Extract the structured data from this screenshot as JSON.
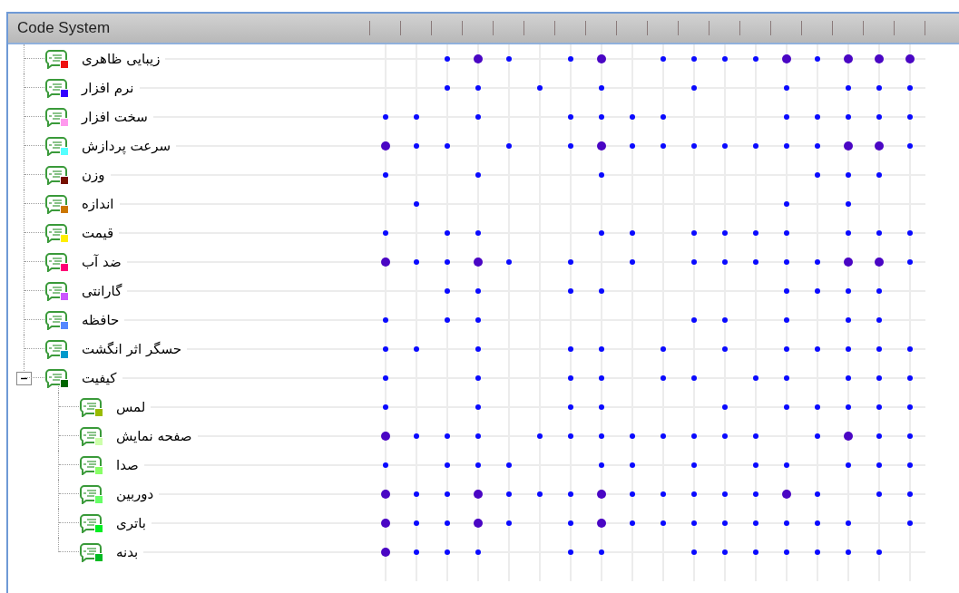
{
  "header": {
    "title": "Code System"
  },
  "codes": [
    {
      "name": "زیبایی ظاهری",
      "color": "#ee1111",
      "cells": [
        {
          "kind": "empty"
        },
        {
          "kind": "empty"
        },
        {
          "kind": "small"
        },
        {
          "kind": "large"
        },
        {
          "kind": "small"
        },
        {
          "kind": "empty"
        },
        {
          "kind": "small"
        },
        {
          "kind": "large"
        },
        {
          "kind": "empty"
        },
        {
          "kind": "small"
        },
        {
          "kind": "small"
        },
        {
          "kind": "small"
        },
        {
          "kind": "small"
        },
        {
          "kind": "large"
        },
        {
          "kind": "small"
        },
        {
          "kind": "large"
        },
        {
          "kind": "large"
        },
        {
          "kind": "large"
        }
      ]
    },
    {
      "name": "نرم افزار",
      "color": "#3300ff",
      "cells": [
        {
          "kind": "empty"
        },
        {
          "kind": "empty"
        },
        {
          "kind": "small"
        },
        {
          "kind": "small"
        },
        {
          "kind": "empty"
        },
        {
          "kind": "small"
        },
        {
          "kind": "empty"
        },
        {
          "kind": "small"
        },
        {
          "kind": "empty"
        },
        {
          "kind": "empty"
        },
        {
          "kind": "small"
        },
        {
          "kind": "empty"
        },
        {
          "kind": "empty"
        },
        {
          "kind": "small"
        },
        {
          "kind": "empty"
        },
        {
          "kind": "small"
        },
        {
          "kind": "small"
        },
        {
          "kind": "small"
        }
      ]
    },
    {
      "name": "سخت افزار",
      "color": "#ff99ee",
      "cells": [
        {
          "kind": "small"
        },
        {
          "kind": "small"
        },
        {
          "kind": "empty"
        },
        {
          "kind": "small"
        },
        {
          "kind": "empty"
        },
        {
          "kind": "empty"
        },
        {
          "kind": "small"
        },
        {
          "kind": "small"
        },
        {
          "kind": "small"
        },
        {
          "kind": "small"
        },
        {
          "kind": "empty"
        },
        {
          "kind": "empty"
        },
        {
          "kind": "empty"
        },
        {
          "kind": "small"
        },
        {
          "kind": "small"
        },
        {
          "kind": "small"
        },
        {
          "kind": "small"
        },
        {
          "kind": "small"
        }
      ]
    },
    {
      "name": "سرعت پردازش",
      "color": "#55ffff",
      "cells": [
        {
          "kind": "large"
        },
        {
          "kind": "small"
        },
        {
          "kind": "small"
        },
        {
          "kind": "empty"
        },
        {
          "kind": "small"
        },
        {
          "kind": "empty"
        },
        {
          "kind": "small"
        },
        {
          "kind": "large"
        },
        {
          "kind": "small"
        },
        {
          "kind": "small"
        },
        {
          "kind": "small"
        },
        {
          "kind": "small"
        },
        {
          "kind": "small"
        },
        {
          "kind": "small"
        },
        {
          "kind": "small"
        },
        {
          "kind": "large"
        },
        {
          "kind": "large"
        },
        {
          "kind": "small"
        }
      ]
    },
    {
      "name": "وزن",
      "color": "#771100",
      "cells": [
        {
          "kind": "small"
        },
        {
          "kind": "empty"
        },
        {
          "kind": "empty"
        },
        {
          "kind": "small"
        },
        {
          "kind": "empty"
        },
        {
          "kind": "empty"
        },
        {
          "kind": "empty"
        },
        {
          "kind": "small"
        },
        {
          "kind": "empty"
        },
        {
          "kind": "empty"
        },
        {
          "kind": "empty"
        },
        {
          "kind": "empty"
        },
        {
          "kind": "empty"
        },
        {
          "kind": "empty"
        },
        {
          "kind": "small"
        },
        {
          "kind": "small"
        },
        {
          "kind": "small"
        },
        {
          "kind": "empty"
        }
      ]
    },
    {
      "name": "اندازه",
      "color": "#cc7700",
      "cells": [
        {
          "kind": "empty"
        },
        {
          "kind": "small"
        },
        {
          "kind": "empty"
        },
        {
          "kind": "empty"
        },
        {
          "kind": "empty"
        },
        {
          "kind": "empty"
        },
        {
          "kind": "empty"
        },
        {
          "kind": "empty"
        },
        {
          "kind": "empty"
        },
        {
          "kind": "empty"
        },
        {
          "kind": "empty"
        },
        {
          "kind": "empty"
        },
        {
          "kind": "empty"
        },
        {
          "kind": "small"
        },
        {
          "kind": "empty"
        },
        {
          "kind": "small"
        },
        {
          "kind": "empty"
        },
        {
          "kind": "empty"
        }
      ]
    },
    {
      "name": "قیمت",
      "color": "#ffee00",
      "cells": [
        {
          "kind": "small"
        },
        {
          "kind": "empty"
        },
        {
          "kind": "small"
        },
        {
          "kind": "small"
        },
        {
          "kind": "empty"
        },
        {
          "kind": "empty"
        },
        {
          "kind": "empty"
        },
        {
          "kind": "small"
        },
        {
          "kind": "small"
        },
        {
          "kind": "empty"
        },
        {
          "kind": "small"
        },
        {
          "kind": "small"
        },
        {
          "kind": "small"
        },
        {
          "kind": "small"
        },
        {
          "kind": "empty"
        },
        {
          "kind": "small"
        },
        {
          "kind": "small"
        },
        {
          "kind": "small"
        }
      ]
    },
    {
      "name": "ضد آب",
      "color": "#ff0077",
      "cells": [
        {
          "kind": "large"
        },
        {
          "kind": "small"
        },
        {
          "kind": "small"
        },
        {
          "kind": "large"
        },
        {
          "kind": "small"
        },
        {
          "kind": "empty"
        },
        {
          "kind": "small"
        },
        {
          "kind": "empty"
        },
        {
          "kind": "small"
        },
        {
          "kind": "empty"
        },
        {
          "kind": "small"
        },
        {
          "kind": "small"
        },
        {
          "kind": "small"
        },
        {
          "kind": "small"
        },
        {
          "kind": "small"
        },
        {
          "kind": "large"
        },
        {
          "kind": "large"
        },
        {
          "kind": "small"
        }
      ]
    },
    {
      "name": "گارانتی",
      "color": "#cc55ff",
      "cells": [
        {
          "kind": "empty"
        },
        {
          "kind": "empty"
        },
        {
          "kind": "small"
        },
        {
          "kind": "small"
        },
        {
          "kind": "empty"
        },
        {
          "kind": "empty"
        },
        {
          "kind": "small"
        },
        {
          "kind": "small"
        },
        {
          "kind": "empty"
        },
        {
          "kind": "empty"
        },
        {
          "kind": "empty"
        },
        {
          "kind": "empty"
        },
        {
          "kind": "empty"
        },
        {
          "kind": "small"
        },
        {
          "kind": "small"
        },
        {
          "kind": "small"
        },
        {
          "kind": "small"
        },
        {
          "kind": "empty"
        }
      ]
    },
    {
      "name": "حافظه",
      "color": "#5588ff",
      "cells": [
        {
          "kind": "small"
        },
        {
          "kind": "empty"
        },
        {
          "kind": "small"
        },
        {
          "kind": "small"
        },
        {
          "kind": "empty"
        },
        {
          "kind": "empty"
        },
        {
          "kind": "empty"
        },
        {
          "kind": "empty"
        },
        {
          "kind": "empty"
        },
        {
          "kind": "empty"
        },
        {
          "kind": "small"
        },
        {
          "kind": "small"
        },
        {
          "kind": "empty"
        },
        {
          "kind": "small"
        },
        {
          "kind": "empty"
        },
        {
          "kind": "small"
        },
        {
          "kind": "small"
        },
        {
          "kind": "empty"
        }
      ]
    },
    {
      "name": "حسگر اثر انگشت",
      "color": "#0099cc",
      "cells": [
        {
          "kind": "small"
        },
        {
          "kind": "small"
        },
        {
          "kind": "empty"
        },
        {
          "kind": "small"
        },
        {
          "kind": "empty"
        },
        {
          "kind": "empty"
        },
        {
          "kind": "small"
        },
        {
          "kind": "small"
        },
        {
          "kind": "empty"
        },
        {
          "kind": "small"
        },
        {
          "kind": "empty"
        },
        {
          "kind": "small"
        },
        {
          "kind": "empty"
        },
        {
          "kind": "small"
        },
        {
          "kind": "small"
        },
        {
          "kind": "small"
        },
        {
          "kind": "small"
        },
        {
          "kind": "small"
        }
      ]
    },
    {
      "name": "کیفیت",
      "color": "#006600",
      "expanded": true,
      "cells": [
        {
          "kind": "small"
        },
        {
          "kind": "empty"
        },
        {
          "kind": "empty"
        },
        {
          "kind": "small"
        },
        {
          "kind": "empty"
        },
        {
          "kind": "empty"
        },
        {
          "kind": "small"
        },
        {
          "kind": "small"
        },
        {
          "kind": "empty"
        },
        {
          "kind": "small"
        },
        {
          "kind": "small"
        },
        {
          "kind": "empty"
        },
        {
          "kind": "small"
        },
        {
          "kind": "small"
        },
        {
          "kind": "empty"
        },
        {
          "kind": "small"
        },
        {
          "kind": "small"
        },
        {
          "kind": "small"
        }
      ],
      "children": [
        {
          "name": "لمس",
          "color": "#99bb00",
          "cells": [
            {
              "kind": "small"
            },
            {
              "kind": "empty"
            },
            {
              "kind": "empty"
            },
            {
              "kind": "small"
            },
            {
              "kind": "empty"
            },
            {
              "kind": "empty"
            },
            {
              "kind": "small"
            },
            {
              "kind": "small"
            },
            {
              "kind": "empty"
            },
            {
              "kind": "empty"
            },
            {
              "kind": "empty"
            },
            {
              "kind": "small"
            },
            {
              "kind": "empty"
            },
            {
              "kind": "small"
            },
            {
              "kind": "small"
            },
            {
              "kind": "small"
            },
            {
              "kind": "small"
            },
            {
              "kind": "small"
            }
          ]
        },
        {
          "name": "صفحه نمایش",
          "color": "#ccffaa",
          "cells": [
            {
              "kind": "large"
            },
            {
              "kind": "small"
            },
            {
              "kind": "small"
            },
            {
              "kind": "small"
            },
            {
              "kind": "empty"
            },
            {
              "kind": "small"
            },
            {
              "kind": "small"
            },
            {
              "kind": "small"
            },
            {
              "kind": "small"
            },
            {
              "kind": "small"
            },
            {
              "kind": "small"
            },
            {
              "kind": "small"
            },
            {
              "kind": "small"
            },
            {
              "kind": "empty"
            },
            {
              "kind": "small"
            },
            {
              "kind": "large"
            },
            {
              "kind": "small"
            },
            {
              "kind": "small"
            }
          ]
        },
        {
          "name": "صدا",
          "color": "#88ff66",
          "cells": [
            {
              "kind": "small"
            },
            {
              "kind": "empty"
            },
            {
              "kind": "small"
            },
            {
              "kind": "small"
            },
            {
              "kind": "small"
            },
            {
              "kind": "empty"
            },
            {
              "kind": "empty"
            },
            {
              "kind": "small"
            },
            {
              "kind": "small"
            },
            {
              "kind": "empty"
            },
            {
              "kind": "small"
            },
            {
              "kind": "empty"
            },
            {
              "kind": "small"
            },
            {
              "kind": "small"
            },
            {
              "kind": "empty"
            },
            {
              "kind": "small"
            },
            {
              "kind": "small"
            },
            {
              "kind": "small"
            }
          ]
        },
        {
          "name": "دوربین",
          "color": "#66ff66",
          "cells": [
            {
              "kind": "large"
            },
            {
              "kind": "small"
            },
            {
              "kind": "small"
            },
            {
              "kind": "large"
            },
            {
              "kind": "small"
            },
            {
              "kind": "small"
            },
            {
              "kind": "small"
            },
            {
              "kind": "large"
            },
            {
              "kind": "small"
            },
            {
              "kind": "small"
            },
            {
              "kind": "small"
            },
            {
              "kind": "small"
            },
            {
              "kind": "small"
            },
            {
              "kind": "large"
            },
            {
              "kind": "small"
            },
            {
              "kind": "empty"
            },
            {
              "kind": "small"
            },
            {
              "kind": "small"
            }
          ]
        },
        {
          "name": "باتری",
          "color": "#00ee22",
          "cells": [
            {
              "kind": "large"
            },
            {
              "kind": "small"
            },
            {
              "kind": "small"
            },
            {
              "kind": "large"
            },
            {
              "kind": "small"
            },
            {
              "kind": "empty"
            },
            {
              "kind": "small"
            },
            {
              "kind": "large"
            },
            {
              "kind": "small"
            },
            {
              "kind": "small"
            },
            {
              "kind": "small"
            },
            {
              "kind": "small"
            },
            {
              "kind": "small"
            },
            {
              "kind": "small"
            },
            {
              "kind": "small"
            },
            {
              "kind": "small"
            },
            {
              "kind": "empty"
            },
            {
              "kind": "small"
            }
          ]
        },
        {
          "name": "بدنه",
          "color": "#00bb22",
          "cells": [
            {
              "kind": "large"
            },
            {
              "kind": "small"
            },
            {
              "kind": "small"
            },
            {
              "kind": "small"
            },
            {
              "kind": "empty"
            },
            {
              "kind": "empty"
            },
            {
              "kind": "small"
            },
            {
              "kind": "small"
            },
            {
              "kind": "empty"
            },
            {
              "kind": "empty"
            },
            {
              "kind": "small"
            },
            {
              "kind": "small"
            },
            {
              "kind": "small"
            },
            {
              "kind": "small"
            },
            {
              "kind": "small"
            },
            {
              "kind": "small"
            },
            {
              "kind": "small"
            },
            {
              "kind": "empty"
            }
          ]
        }
      ]
    }
  ]
}
